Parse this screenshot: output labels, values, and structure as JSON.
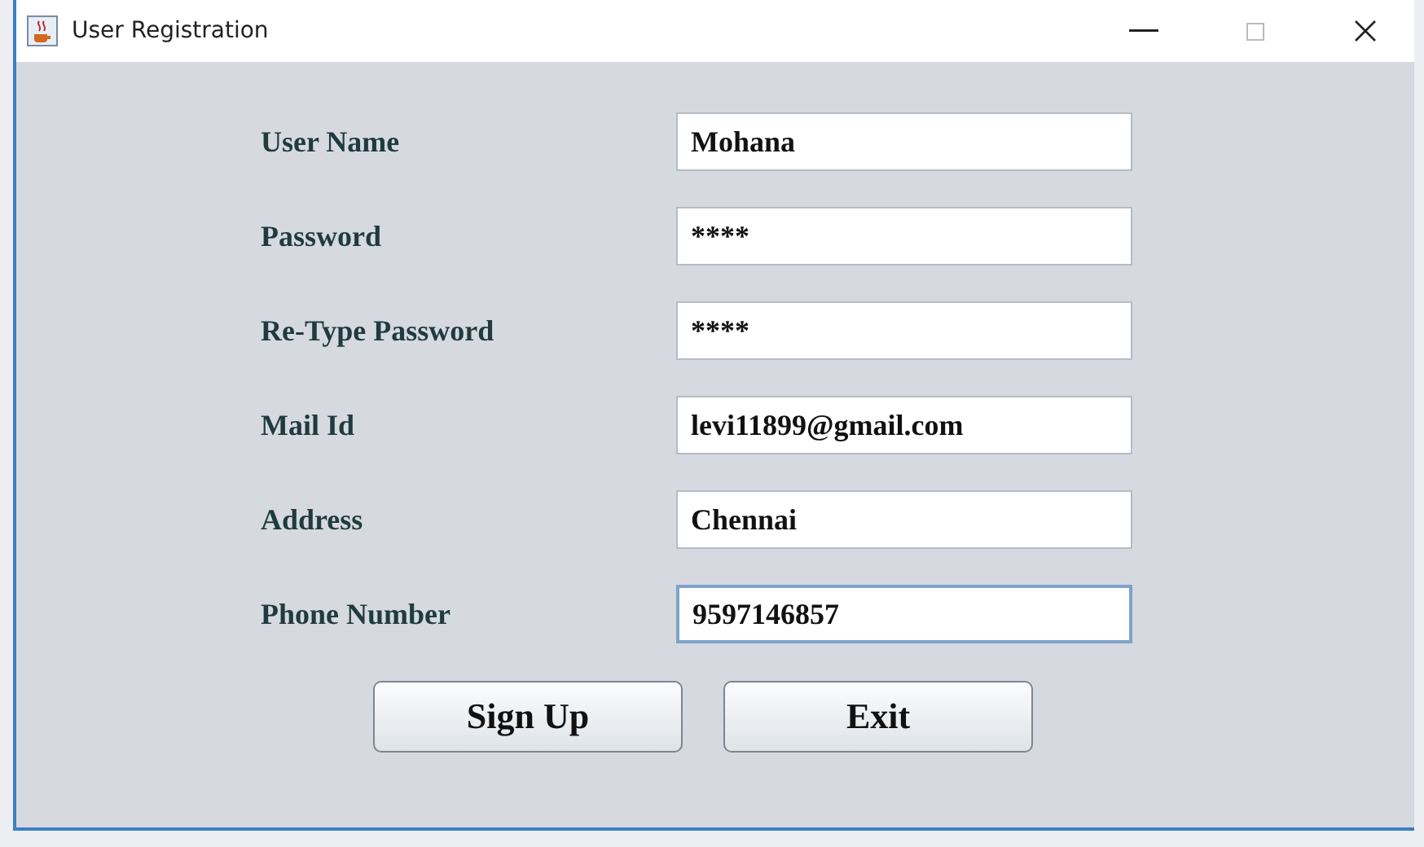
{
  "window": {
    "title": "User Registration"
  },
  "fields": [
    {
      "label": "User Name",
      "value": "Mohana",
      "focused": false
    },
    {
      "label": "Password",
      "value": "****",
      "focused": false
    },
    {
      "label": "Re-Type Password",
      "value": "****",
      "focused": false
    },
    {
      "label": "Mail Id",
      "value": "levi11899@gmail.com",
      "focused": false
    },
    {
      "label": "Address",
      "value": "Chennai",
      "focused": false
    },
    {
      "label": "Phone Number",
      "value": "9597146857",
      "focused": true
    }
  ],
  "buttons": [
    "Sign Up",
    "Exit"
  ]
}
